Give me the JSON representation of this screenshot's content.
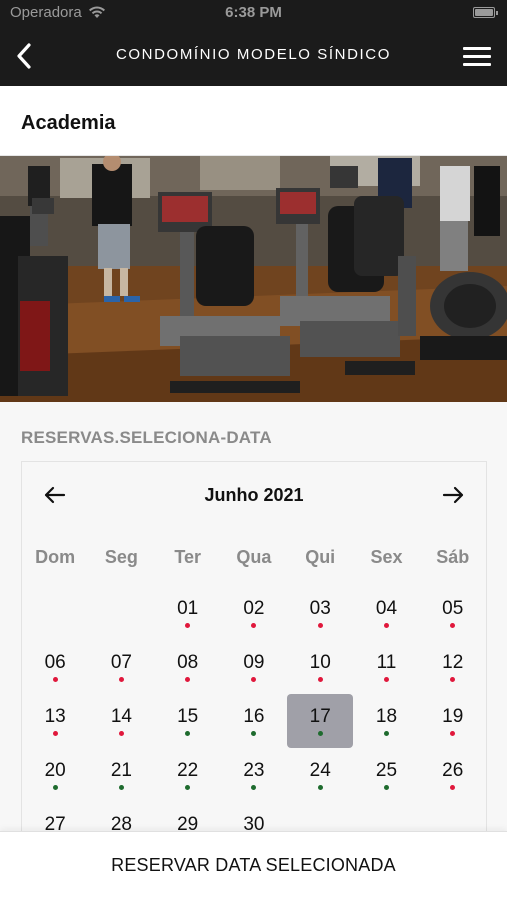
{
  "status_bar": {
    "carrier": "Operadora",
    "time": "6:38 PM"
  },
  "nav": {
    "title": "CONDOMÍNIO MODELO SÍNDICO",
    "back_icon": "chevron-left-icon",
    "menu_icon": "hamburger-menu-icon"
  },
  "page": {
    "title": "Academia"
  },
  "hero_image": {
    "description_icon": "gym-photo"
  },
  "reservation": {
    "section_label": "RESERVAS.SELECIONA-DATA",
    "month_title": "Junho 2021",
    "weekdays": [
      "Dom",
      "Seg",
      "Ter",
      "Qua",
      "Qui",
      "Sex",
      "Sáb"
    ],
    "leading_blanks": 2,
    "selected_day": "17",
    "available_color": "#1e6b2e",
    "unavailable_color": "#e0183c",
    "days": [
      {
        "n": "01",
        "status": "red"
      },
      {
        "n": "02",
        "status": "red"
      },
      {
        "n": "03",
        "status": "red"
      },
      {
        "n": "04",
        "status": "red"
      },
      {
        "n": "05",
        "status": "red"
      },
      {
        "n": "06",
        "status": "red"
      },
      {
        "n": "07",
        "status": "red"
      },
      {
        "n": "08",
        "status": "red"
      },
      {
        "n": "09",
        "status": "red"
      },
      {
        "n": "10",
        "status": "red"
      },
      {
        "n": "11",
        "status": "red"
      },
      {
        "n": "12",
        "status": "red"
      },
      {
        "n": "13",
        "status": "red"
      },
      {
        "n": "14",
        "status": "red"
      },
      {
        "n": "15",
        "status": "green"
      },
      {
        "n": "16",
        "status": "green"
      },
      {
        "n": "17",
        "status": "green"
      },
      {
        "n": "18",
        "status": "green"
      },
      {
        "n": "19",
        "status": "red"
      },
      {
        "n": "20",
        "status": "green"
      },
      {
        "n": "21",
        "status": "green"
      },
      {
        "n": "22",
        "status": "green"
      },
      {
        "n": "23",
        "status": "green"
      },
      {
        "n": "24",
        "status": "green"
      },
      {
        "n": "25",
        "status": "green"
      },
      {
        "n": "26",
        "status": "red"
      },
      {
        "n": "27",
        "status": "green"
      },
      {
        "n": "28",
        "status": "green"
      },
      {
        "n": "29",
        "status": "green"
      },
      {
        "n": "30",
        "status": "green"
      }
    ]
  },
  "bottom": {
    "reserve_label": "RESERVAR DATA SELECIONADA"
  }
}
